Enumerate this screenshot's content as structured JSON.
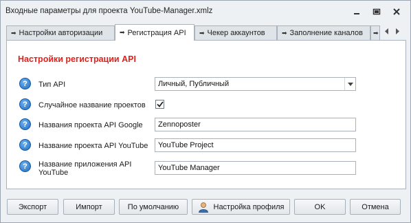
{
  "window": {
    "title": "Входные параметры для проекта YouTube-Manager.xmlz",
    "controls": [
      "minimize-icon",
      "restore-icon",
      "close-icon"
    ]
  },
  "tabs": [
    {
      "label": "Настройки авторизации",
      "active": false
    },
    {
      "label": "Регистрация API",
      "active": true
    },
    {
      "label": "Чекер аккаунтов",
      "active": false
    },
    {
      "label": "Заполнение каналов",
      "active": false
    },
    {
      "label": "",
      "active": false
    }
  ],
  "tab_nav": [
    "chevron-left-icon",
    "chevron-right-icon"
  ],
  "section": {
    "title": "Настройки регистрации API"
  },
  "fields": {
    "api_type": {
      "label": "Тип API",
      "value": "Личный, Публичный"
    },
    "random_name": {
      "label": "Случайное название проектов",
      "checked": true
    },
    "google_project_name": {
      "label": "Названия проекта API Google",
      "value": "Zennoposter"
    },
    "youtube_project_name": {
      "label": "Название проекта API YouTube",
      "value": "YouTube Project"
    },
    "app_name": {
      "label": "Название приложения API YouTube",
      "value": "YouTube Manager"
    }
  },
  "footer": {
    "export": "Экспорт",
    "import": "Импорт",
    "defaults": "По умолчанию",
    "profile": "Настройка профиля",
    "ok": "OK",
    "cancel": "Отмена"
  },
  "colors": {
    "section_title": "#e0201b",
    "help_icon": "#1f6cc0",
    "window_bg": "#eef1f4"
  }
}
